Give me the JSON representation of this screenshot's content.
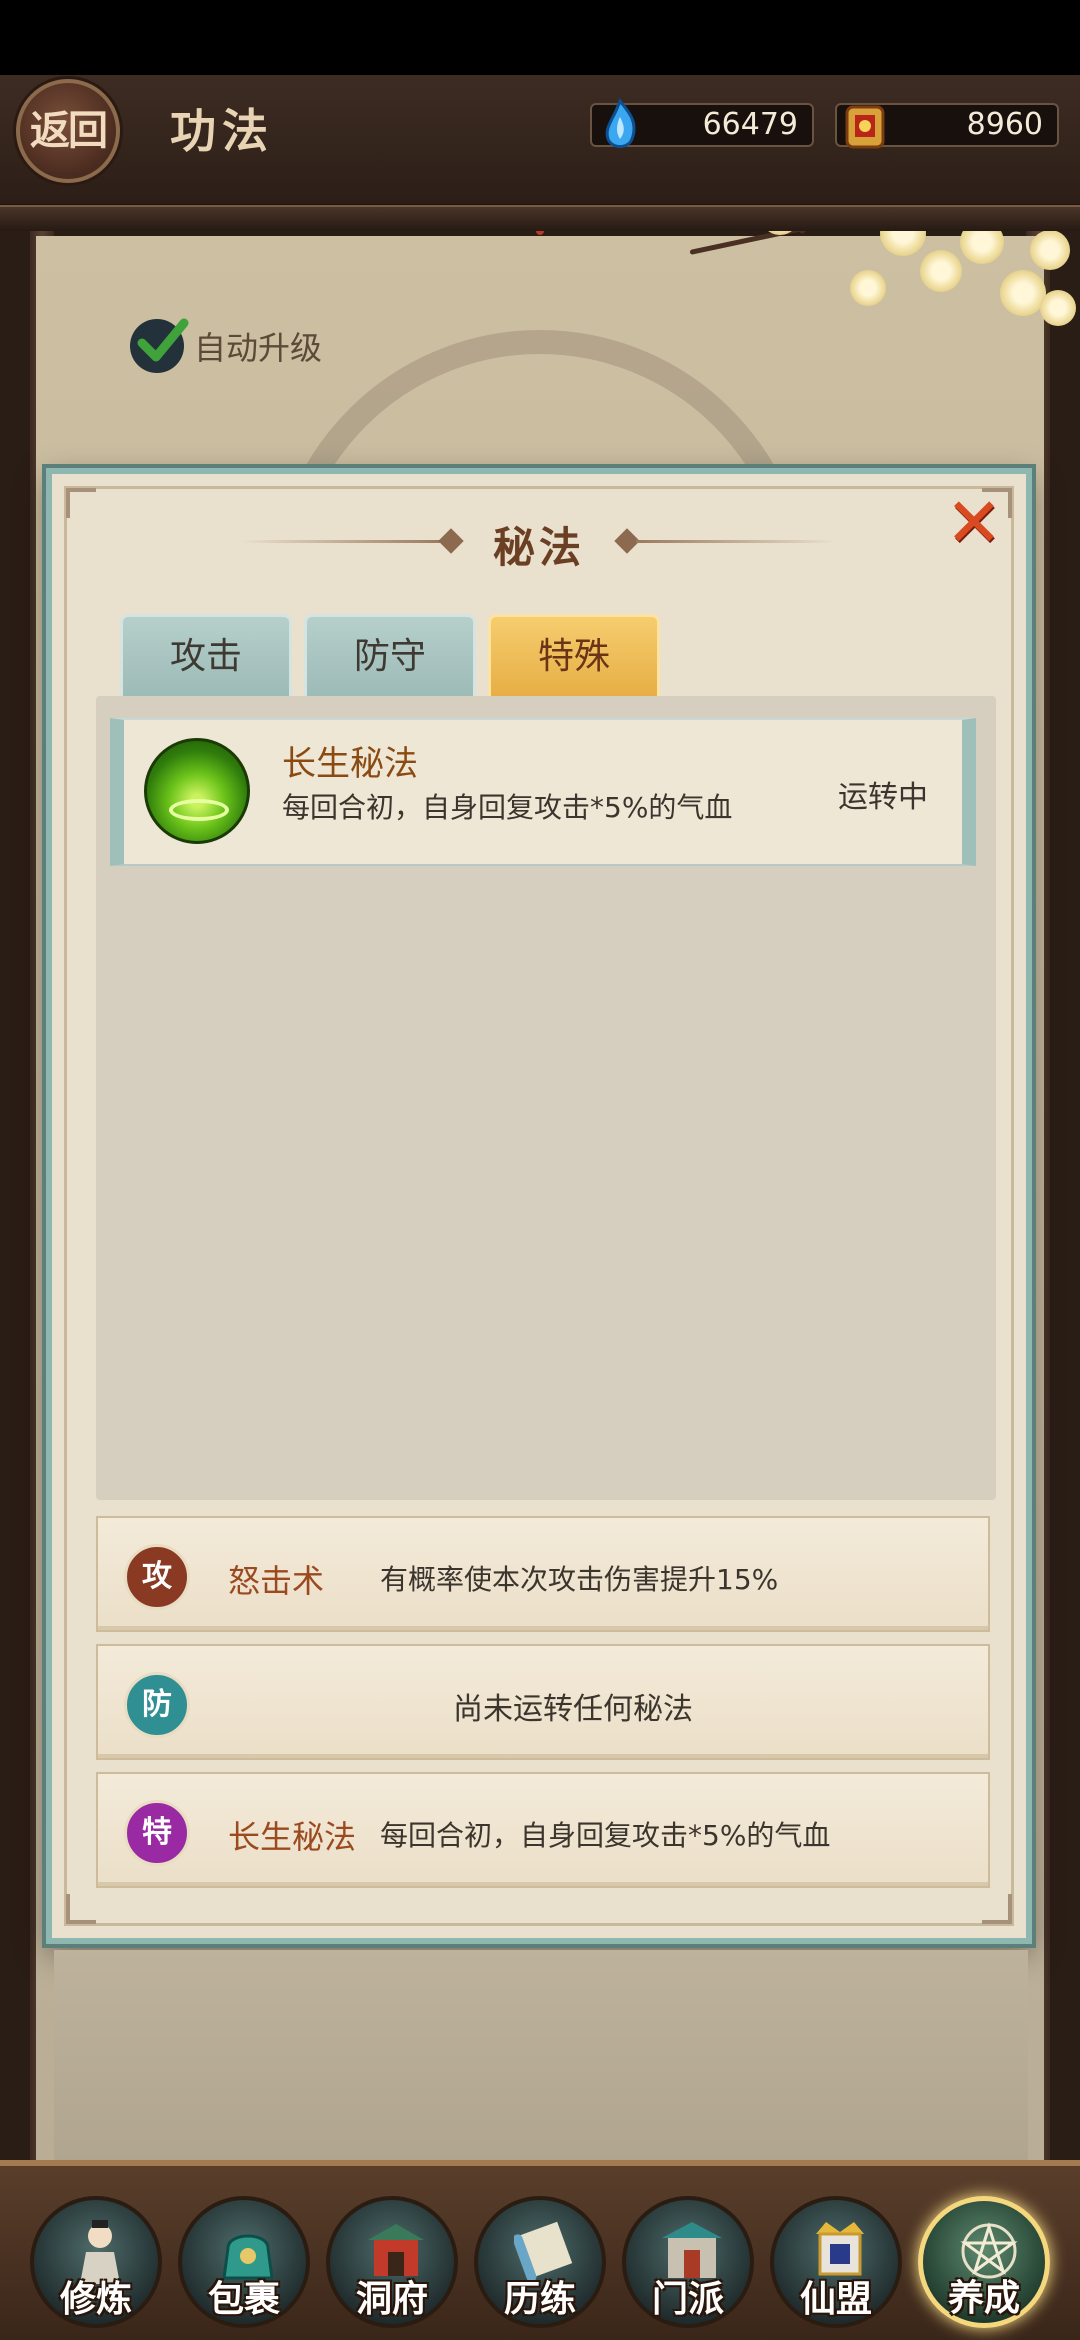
{
  "header": {
    "back_label": "返回",
    "title": "功法",
    "spirit_stones": "66479",
    "gold_ingots": "8960"
  },
  "auto_upgrade": {
    "label": "自动升级",
    "checked": true
  },
  "dialog": {
    "title": "秘法",
    "tabs": [
      {
        "label": "攻击",
        "active": false
      },
      {
        "label": "防守",
        "active": false
      },
      {
        "label": "特殊",
        "active": true
      }
    ],
    "list": [
      {
        "name": "长生秘法",
        "description": "每回合初，自身回复攻击*5%的气血",
        "status": "运转中",
        "icon": "green-orb-icon"
      }
    ],
    "equipped": [
      {
        "badge": "攻",
        "name": "怒击术",
        "description": "有概率使本次攻击伤害提升15%",
        "color": "#8a3a22"
      },
      {
        "badge": "防",
        "name": "",
        "description": "尚未运转任何秘法",
        "color": "#2f8f93"
      },
      {
        "badge": "特",
        "name": "长生秘法",
        "description": "每回合初，自身回复攻击*5%的气血",
        "color": "#9a2aa3"
      }
    ]
  },
  "bottom_nav": [
    {
      "label": "修炼",
      "icon": "cultivator-icon",
      "active": false
    },
    {
      "label": "包裹",
      "icon": "bag-icon",
      "active": false
    },
    {
      "label": "洞府",
      "icon": "cave-palace-icon",
      "active": false
    },
    {
      "label": "历练",
      "icon": "scroll-icon",
      "active": false
    },
    {
      "label": "门派",
      "icon": "sect-gate-icon",
      "active": false
    },
    {
      "label": "仙盟",
      "icon": "alliance-icon",
      "active": false
    },
    {
      "label": "养成",
      "icon": "pentagram-icon",
      "active": true
    }
  ]
}
